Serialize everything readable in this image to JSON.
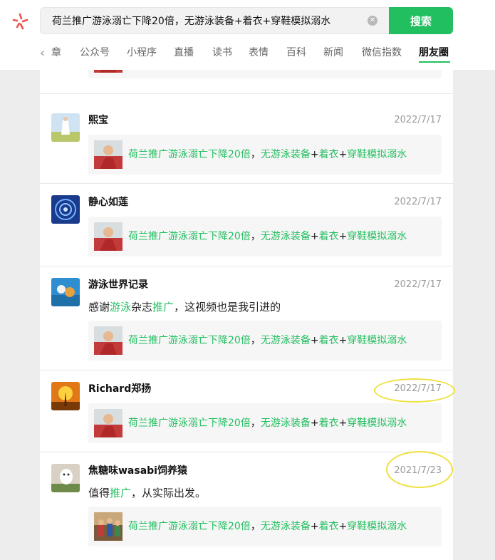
{
  "search": {
    "query": "荷兰推广游泳溺亡下降20倍，无游泳装备+着衣+穿鞋模拟溺水",
    "button_label": "搜索"
  },
  "tabs": {
    "partial": "章",
    "items": [
      "公众号",
      "小程序",
      "直播",
      "读书",
      "表情",
      "百科",
      "新闻",
      "微信指数"
    ],
    "active": "朋友圈"
  },
  "card_title": {
    "seg1": "荷兰推广游泳溺亡下降20倍",
    "comma": "，",
    "seg2": "无游泳装备",
    "plus1": "+",
    "seg3": "着衣",
    "plus2": "+",
    "seg4": "穿鞋模拟溺水"
  },
  "posts": [
    {
      "user": "熙宝",
      "date": "2022/7/17"
    },
    {
      "user": "静心如莲",
      "date": "2022/7/17"
    },
    {
      "user": "游泳世界记录",
      "date": "2022/7/17",
      "text_a": "感谢",
      "text_h1": "游泳",
      "text_b": "杂志",
      "text_h2": "推广",
      "text_c": "，这视频也是我引进的"
    },
    {
      "user": "Richard郑扬",
      "date": "2022/7/17"
    },
    {
      "user": "焦糖味wasabi饲养猿",
      "date": "2021/7/23",
      "text_a": "值得",
      "text_h1": "推广",
      "text_b": "，从实际出发。"
    }
  ],
  "colors": {
    "accent": "#22bf60",
    "annotation": "#f0e040"
  }
}
